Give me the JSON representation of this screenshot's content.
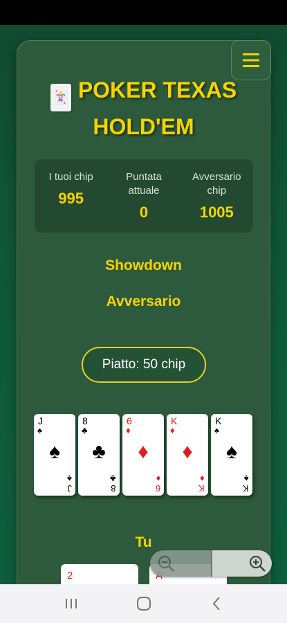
{
  "header": {
    "title": "POKER TEXAS HOLD'EM",
    "logo_icon": "joker-card-icon",
    "menu_icon": "hamburger-menu-icon"
  },
  "stats": {
    "my_chips_label": "I tuoi chip",
    "my_chips_value": "995",
    "current_bet_label": "Puntata attuale",
    "current_bet_value": "0",
    "opponent_chips_label": "Avversario chip",
    "opponent_chips_value": "1005"
  },
  "game": {
    "phase": "Showdown",
    "opponent_label": "Avversario",
    "pot": "Piatto: 50 chip",
    "you_label": "Tu"
  },
  "community_cards": [
    {
      "rank": "J",
      "suit": "♠",
      "color": "black"
    },
    {
      "rank": "8",
      "suit": "♣",
      "color": "black"
    },
    {
      "rank": "6",
      "suit": "♦",
      "color": "red"
    },
    {
      "rank": "K",
      "suit": "♦",
      "color": "red"
    },
    {
      "rank": "K",
      "suit": "♠",
      "color": "black"
    }
  ],
  "player_cards": [
    {
      "rank": "2",
      "color": "red"
    },
    {
      "rank": "A",
      "color": "red"
    }
  ],
  "zoom_controls": {
    "zoom_out_icon": "zoom-out-icon",
    "zoom_in_icon": "zoom-in-icon"
  },
  "system_nav": {
    "recents_icon": "recents-icon",
    "home_icon": "home-icon",
    "back_icon": "back-icon"
  },
  "colors": {
    "background": "#114a31",
    "panel": "#2d5a3c",
    "accent_yellow": "#f5d400",
    "card_red": "#e11c1c"
  }
}
